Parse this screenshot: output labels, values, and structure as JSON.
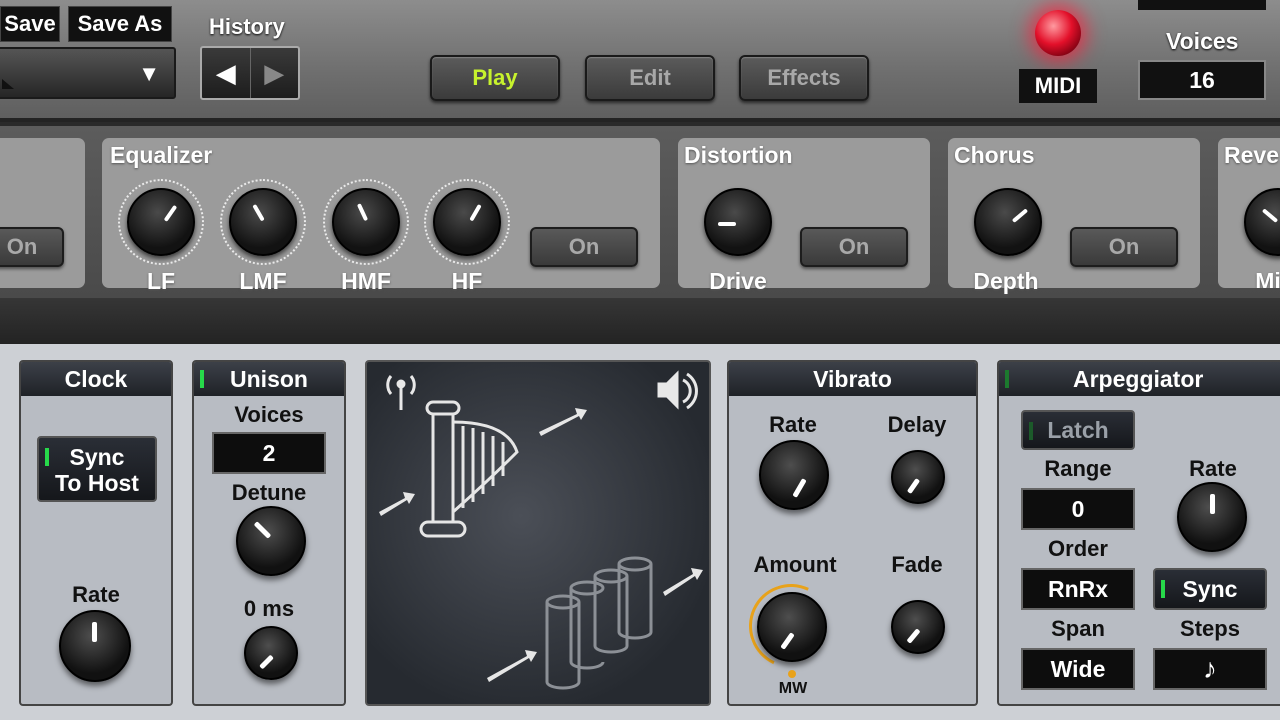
{
  "toolbar": {
    "save_label": "Save",
    "save_as_label": "Save As",
    "preset_value": "",
    "history_label": "History",
    "history_back": "◀",
    "history_forward": "▶",
    "modes": {
      "play": "Play",
      "edit": "Edit",
      "effects": "Effects"
    },
    "active_mode": "Play",
    "midi_label": "MIDI",
    "voices_label": "Voices",
    "voices_value": "16"
  },
  "effects": {
    "left_panel": {
      "on_label": "On"
    },
    "equalizer": {
      "title": "Equalizer",
      "knobs": [
        "LF",
        "LMF",
        "HMF",
        "HF"
      ],
      "on_label": "On"
    },
    "distortion": {
      "title": "Distortion",
      "knob": "Drive",
      "on_label": "On"
    },
    "chorus": {
      "title": "Chorus",
      "knob": "Depth",
      "on_label": "On"
    },
    "reverb": {
      "title": "Reve",
      "knob": "Mi"
    }
  },
  "clock": {
    "title": "Clock",
    "sync_line1": "Sync",
    "sync_line2": "To Host",
    "rate_label": "Rate"
  },
  "unison": {
    "title": "Unison",
    "voices_label": "Voices",
    "voices_value": "2",
    "detune_label": "Detune",
    "time_label": "0 ms"
  },
  "vibrato": {
    "title": "Vibrato",
    "rate_label": "Rate",
    "delay_label": "Delay",
    "amount_label": "Amount",
    "fade_label": "Fade",
    "mw_label": "MW"
  },
  "arpeggiator": {
    "title": "Arpeggiator",
    "latch_label": "Latch",
    "range_label": "Range",
    "range_value": "0",
    "rate_label": "Rate",
    "order_label": "Order",
    "order_value": "RnRx",
    "sync_label": "Sync",
    "span_label": "Span",
    "span_value": "Wide",
    "steps_label": "Steps",
    "steps_value": "♪"
  },
  "colors": {
    "play_active": "#c7f22d",
    "led_green": "#27d94a",
    "midi_red": "#e3102a",
    "mw_arc": "#e8a21a"
  }
}
